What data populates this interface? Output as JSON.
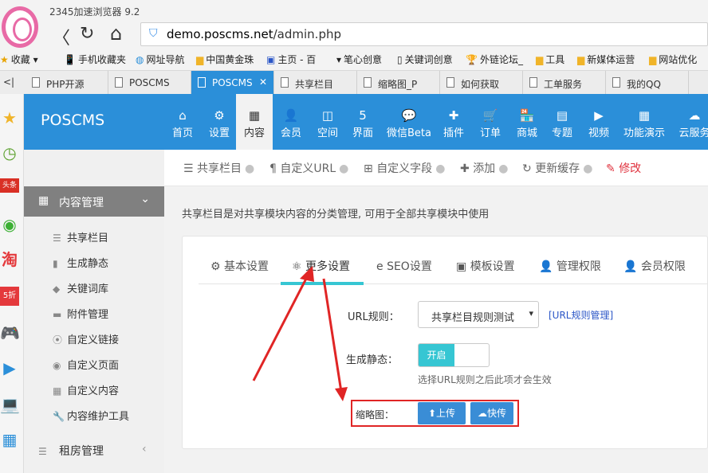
{
  "browser": {
    "app_name": "2345加速浏览器 9.2",
    "back_glyph": "〈",
    "refresh_glyph": "↻",
    "home_glyph": "⌂",
    "url_host": "demo.poscms.net",
    "url_path": "/admin.php",
    "bookmarks": [
      "收藏",
      "手机收藏夹",
      "网址导航",
      "中国黄金珠",
      "主页 - 百",
      "笔心创意",
      "关键词创意",
      "外链论坛_",
      "工具",
      "新媒体运营",
      "网站优化"
    ],
    "tabs": [
      "PHP开源",
      "POSCMS",
      "POSCMS",
      "共享栏目",
      "缩略图_P",
      "如何获取",
      "工单服务",
      "我的QQ"
    ],
    "active_tab_index": 2,
    "sidebar_icons": [
      "★",
      "◷",
      "头条",
      "◉",
      "淘",
      "5折",
      "🎮",
      "▶",
      "💻",
      "▦"
    ]
  },
  "app": {
    "brand": "POSCMS",
    "accent_color": "#2b8fd9",
    "menu": [
      {
        "icon": "⌂",
        "label": "首页"
      },
      {
        "icon": "⚙",
        "label": "设置"
      },
      {
        "icon": "▦",
        "label": "内容"
      },
      {
        "icon": "👤",
        "label": "会员"
      },
      {
        "icon": "◫",
        "label": "空间"
      },
      {
        "icon": "5",
        "label": "界面"
      },
      {
        "icon": "💬",
        "label": "微信Beta"
      },
      {
        "icon": "✚",
        "label": "插件"
      },
      {
        "icon": "🛒",
        "label": "订单"
      },
      {
        "icon": "🏪",
        "label": "商城"
      },
      {
        "icon": "▤",
        "label": "专题"
      },
      {
        "icon": "▶",
        "label": "视频"
      },
      {
        "icon": "▦",
        "label": "功能演示"
      },
      {
        "icon": "☁",
        "label": "云服务"
      }
    ],
    "active_menu_index": 2
  },
  "leftnav": {
    "section_title": "内容管理",
    "items": [
      {
        "icon": "☰",
        "label": "共享栏目"
      },
      {
        "icon": "▮",
        "label": "生成静态"
      },
      {
        "icon": "◆",
        "label": "关键词库"
      },
      {
        "icon": "▬",
        "label": "附件管理"
      },
      {
        "icon": "⦿",
        "label": "自定义链接"
      },
      {
        "icon": "◉",
        "label": "自定义页面"
      },
      {
        "icon": "▦",
        "label": "自定义内容"
      },
      {
        "icon": "🔧",
        "label": "内容维护工具"
      }
    ],
    "section2_title": "租房管理"
  },
  "toolbar": {
    "items": [
      "共享栏目",
      "自定义URL",
      "自定义字段",
      "添加",
      "更新缓存",
      "修改"
    ],
    "icons": [
      "☰",
      "¶",
      "⊞",
      "✚",
      "↻",
      "✎"
    ],
    "separator": "●"
  },
  "description": "共享栏目是对共享模块内容的分类管理, 可用于全部共享模块中使用",
  "panel": {
    "tabs": [
      {
        "icon": "⚙",
        "label": "基本设置"
      },
      {
        "icon": "⚛",
        "label": "更多设置"
      },
      {
        "icon": "e",
        "label": "SEO设置"
      },
      {
        "icon": "▣",
        "label": "模板设置"
      },
      {
        "icon": "👤",
        "label": "管理权限"
      },
      {
        "icon": "👤",
        "label": "会员权限"
      }
    ],
    "active_tab_index": 1,
    "url_rule_label": "URL规则：",
    "url_rule_value": "共享栏目规则测试",
    "url_rule_manage": "[URL规则管理]",
    "static_label": "生成静态：",
    "toggle_on": "开启",
    "static_hint": "选择URL规则之后此项才会生效",
    "thumb_label": "缩略图：",
    "upload_btn": "⬆上传",
    "quick_btn": "☁快传"
  }
}
